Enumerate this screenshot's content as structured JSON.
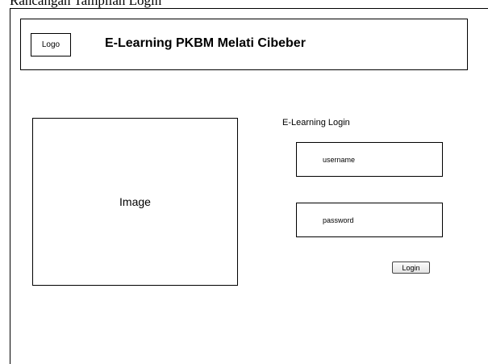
{
  "caption_fragment": "Rancangan Tampilan Login",
  "header": {
    "logo_label": "Logo",
    "site_title": "E-Learning PKBM Melati Cibeber"
  },
  "main": {
    "image_label": "Image"
  },
  "login": {
    "title": "E-Learning Login",
    "username_placeholder": "username",
    "password_placeholder": "password",
    "button_label": "Login"
  }
}
